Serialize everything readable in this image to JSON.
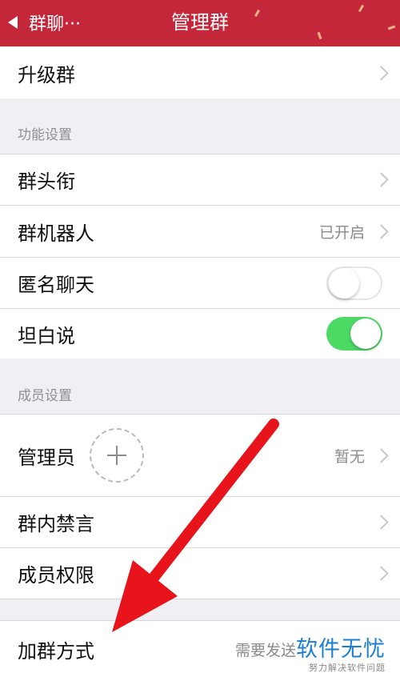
{
  "nav": {
    "back_label": "群聊···",
    "title": "管理群",
    "color": "#c5273a"
  },
  "rows": {
    "upgrade": {
      "label": "升级群"
    },
    "group_title": {
      "label": "群头衔"
    },
    "group_robot": {
      "label": "群机器人",
      "value": "已开启"
    },
    "anonymous_chat": {
      "label": "匿名聊天",
      "enabled": false
    },
    "frank_talk": {
      "label": "坦白说",
      "enabled": true
    },
    "admins": {
      "label": "管理员",
      "value": "暂无"
    },
    "mute": {
      "label": "群内禁言"
    },
    "member_perms": {
      "label": "成员权限"
    },
    "join_method": {
      "label": "加群方式",
      "value": "需要发送"
    }
  },
  "sections": {
    "features": "功能设置",
    "members": "成员设置"
  },
  "annotation": {
    "arrow_color": "#e8141c"
  },
  "watermark": {
    "brand": "软件无忧",
    "slogan": "努力解决软件问题"
  },
  "colors": {
    "toggle_on": "#4cd964",
    "chevron": "#c7c7cc",
    "background": "#efeff4"
  }
}
